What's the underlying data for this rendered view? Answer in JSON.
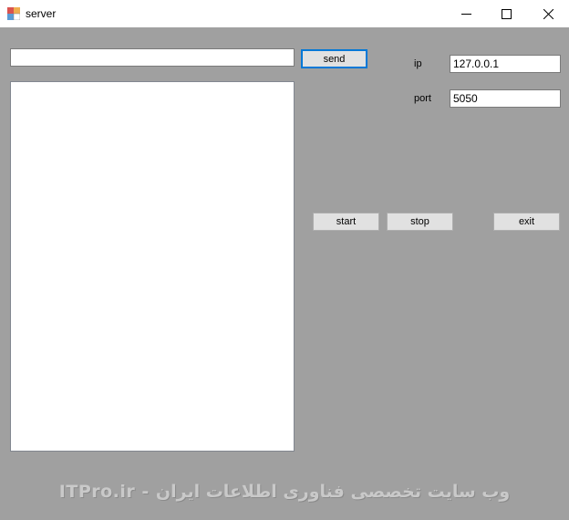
{
  "window": {
    "title": "server",
    "controls": {
      "minimize_icon": "minimize-icon",
      "maximize_icon": "maximize-icon",
      "close_icon": "close-icon"
    }
  },
  "message": {
    "input_value": "",
    "send_label": "send"
  },
  "log": {
    "items": []
  },
  "connection": {
    "ip_label": "ip",
    "ip_value": "127.0.0.1",
    "port_label": "port",
    "port_value": "5050"
  },
  "actions": {
    "start_label": "start",
    "stop_label": "stop",
    "exit_label": "exit"
  },
  "watermark": {
    "text": "ITPro.ir - وب سایت تخصصی فناوری اطلاعات ایران"
  },
  "colors": {
    "form_background": "#a0a0a0",
    "titlebar": "#ffffff",
    "button_face": "#e1e1e1",
    "focus_border": "#0078d7"
  }
}
